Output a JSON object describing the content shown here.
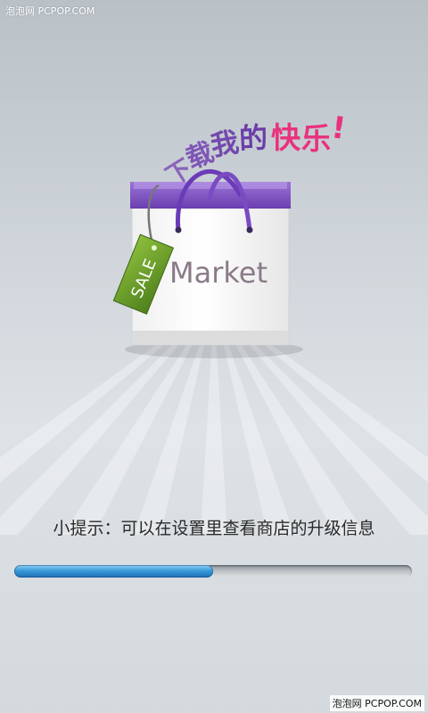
{
  "watermark": {
    "top": "泡泡网 PCPOP.COM",
    "bottom": "泡泡网 PCPOP.COM"
  },
  "tagline": {
    "chars": [
      "下",
      "载",
      "我",
      "的",
      "快",
      "乐",
      "!"
    ]
  },
  "bag": {
    "brand_text": "Market",
    "tag_text": "SALE"
  },
  "hint": {
    "text": "小提示：可以在设置里查看商店的升级信息"
  },
  "progress": {
    "fraction": 0.5
  },
  "colors": {
    "tagline_purple": "#7a4bb0",
    "tagline_pink": "#e8327e",
    "bag_purple": "#6d3fb2",
    "tag_green": "#6a9a2a",
    "progress_blue": "#2b84c6"
  }
}
